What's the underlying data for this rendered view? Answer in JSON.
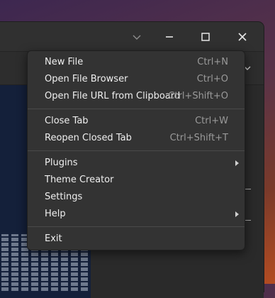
{
  "menu": {
    "items": [
      {
        "label": "New File",
        "accel": "Ctrl+N"
      },
      {
        "label": "Open File Browser",
        "accel": "Ctrl+O"
      },
      {
        "label": "Open File URL from Clipboard",
        "accel": "Ctrl+Shift+O"
      },
      {
        "label": "Close Tab",
        "accel": "Ctrl+W"
      },
      {
        "label": "Reopen Closed Tab",
        "accel": "Ctrl+Shift+T"
      },
      {
        "label": "Plugins",
        "submenu": true
      },
      {
        "label": "Theme Creator"
      },
      {
        "label": "Settings"
      },
      {
        "label": "Help",
        "submenu": true
      },
      {
        "label": "Exit"
      }
    ]
  },
  "window": {
    "controls": [
      "chevron-down-icon",
      "minimize-icon",
      "maximize-icon",
      "close-icon"
    ]
  }
}
